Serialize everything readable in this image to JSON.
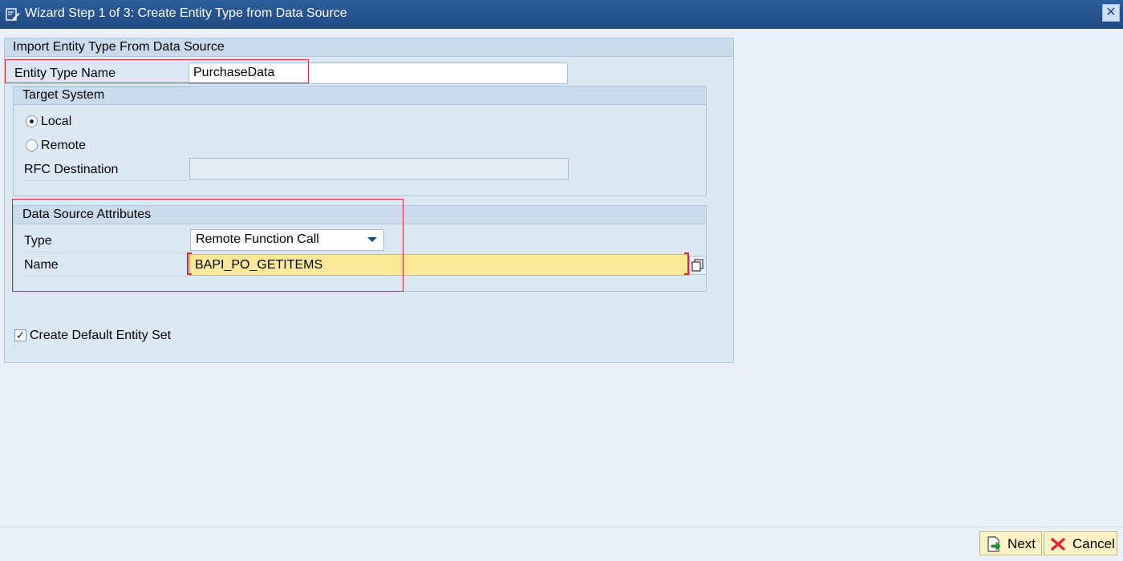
{
  "window": {
    "title": "Wizard Step 1 of 3: Create Entity Type from Data Source",
    "close_label": "✕"
  },
  "panel": {
    "title": "Import Entity Type From Data Source",
    "entity_type_name_label": "Entity Type Name",
    "entity_type_name_value": "PurchaseData"
  },
  "target_system": {
    "title": "Target System",
    "local_label": "Local",
    "local_selected": true,
    "remote_label": "Remote",
    "remote_selected": false,
    "rfc_destination_label": "RFC Destination",
    "rfc_destination_value": ""
  },
  "data_source": {
    "title": "Data Source Attributes",
    "type_label": "Type",
    "type_value": "Remote Function Call",
    "name_label": "Name",
    "name_value": "BAPI_PO_GETITEMS"
  },
  "options": {
    "create_default_entity_set_label": "Create Default Entity Set",
    "create_default_entity_set_checked": true,
    "check_glyph": "✓"
  },
  "footer": {
    "next_label": "Next",
    "cancel_label": "Cancel"
  },
  "colors": {
    "title_bar": "#1e4a80",
    "highlight": "#e0262c",
    "required_field": "#fde99a",
    "button": "#fdf3c6"
  }
}
